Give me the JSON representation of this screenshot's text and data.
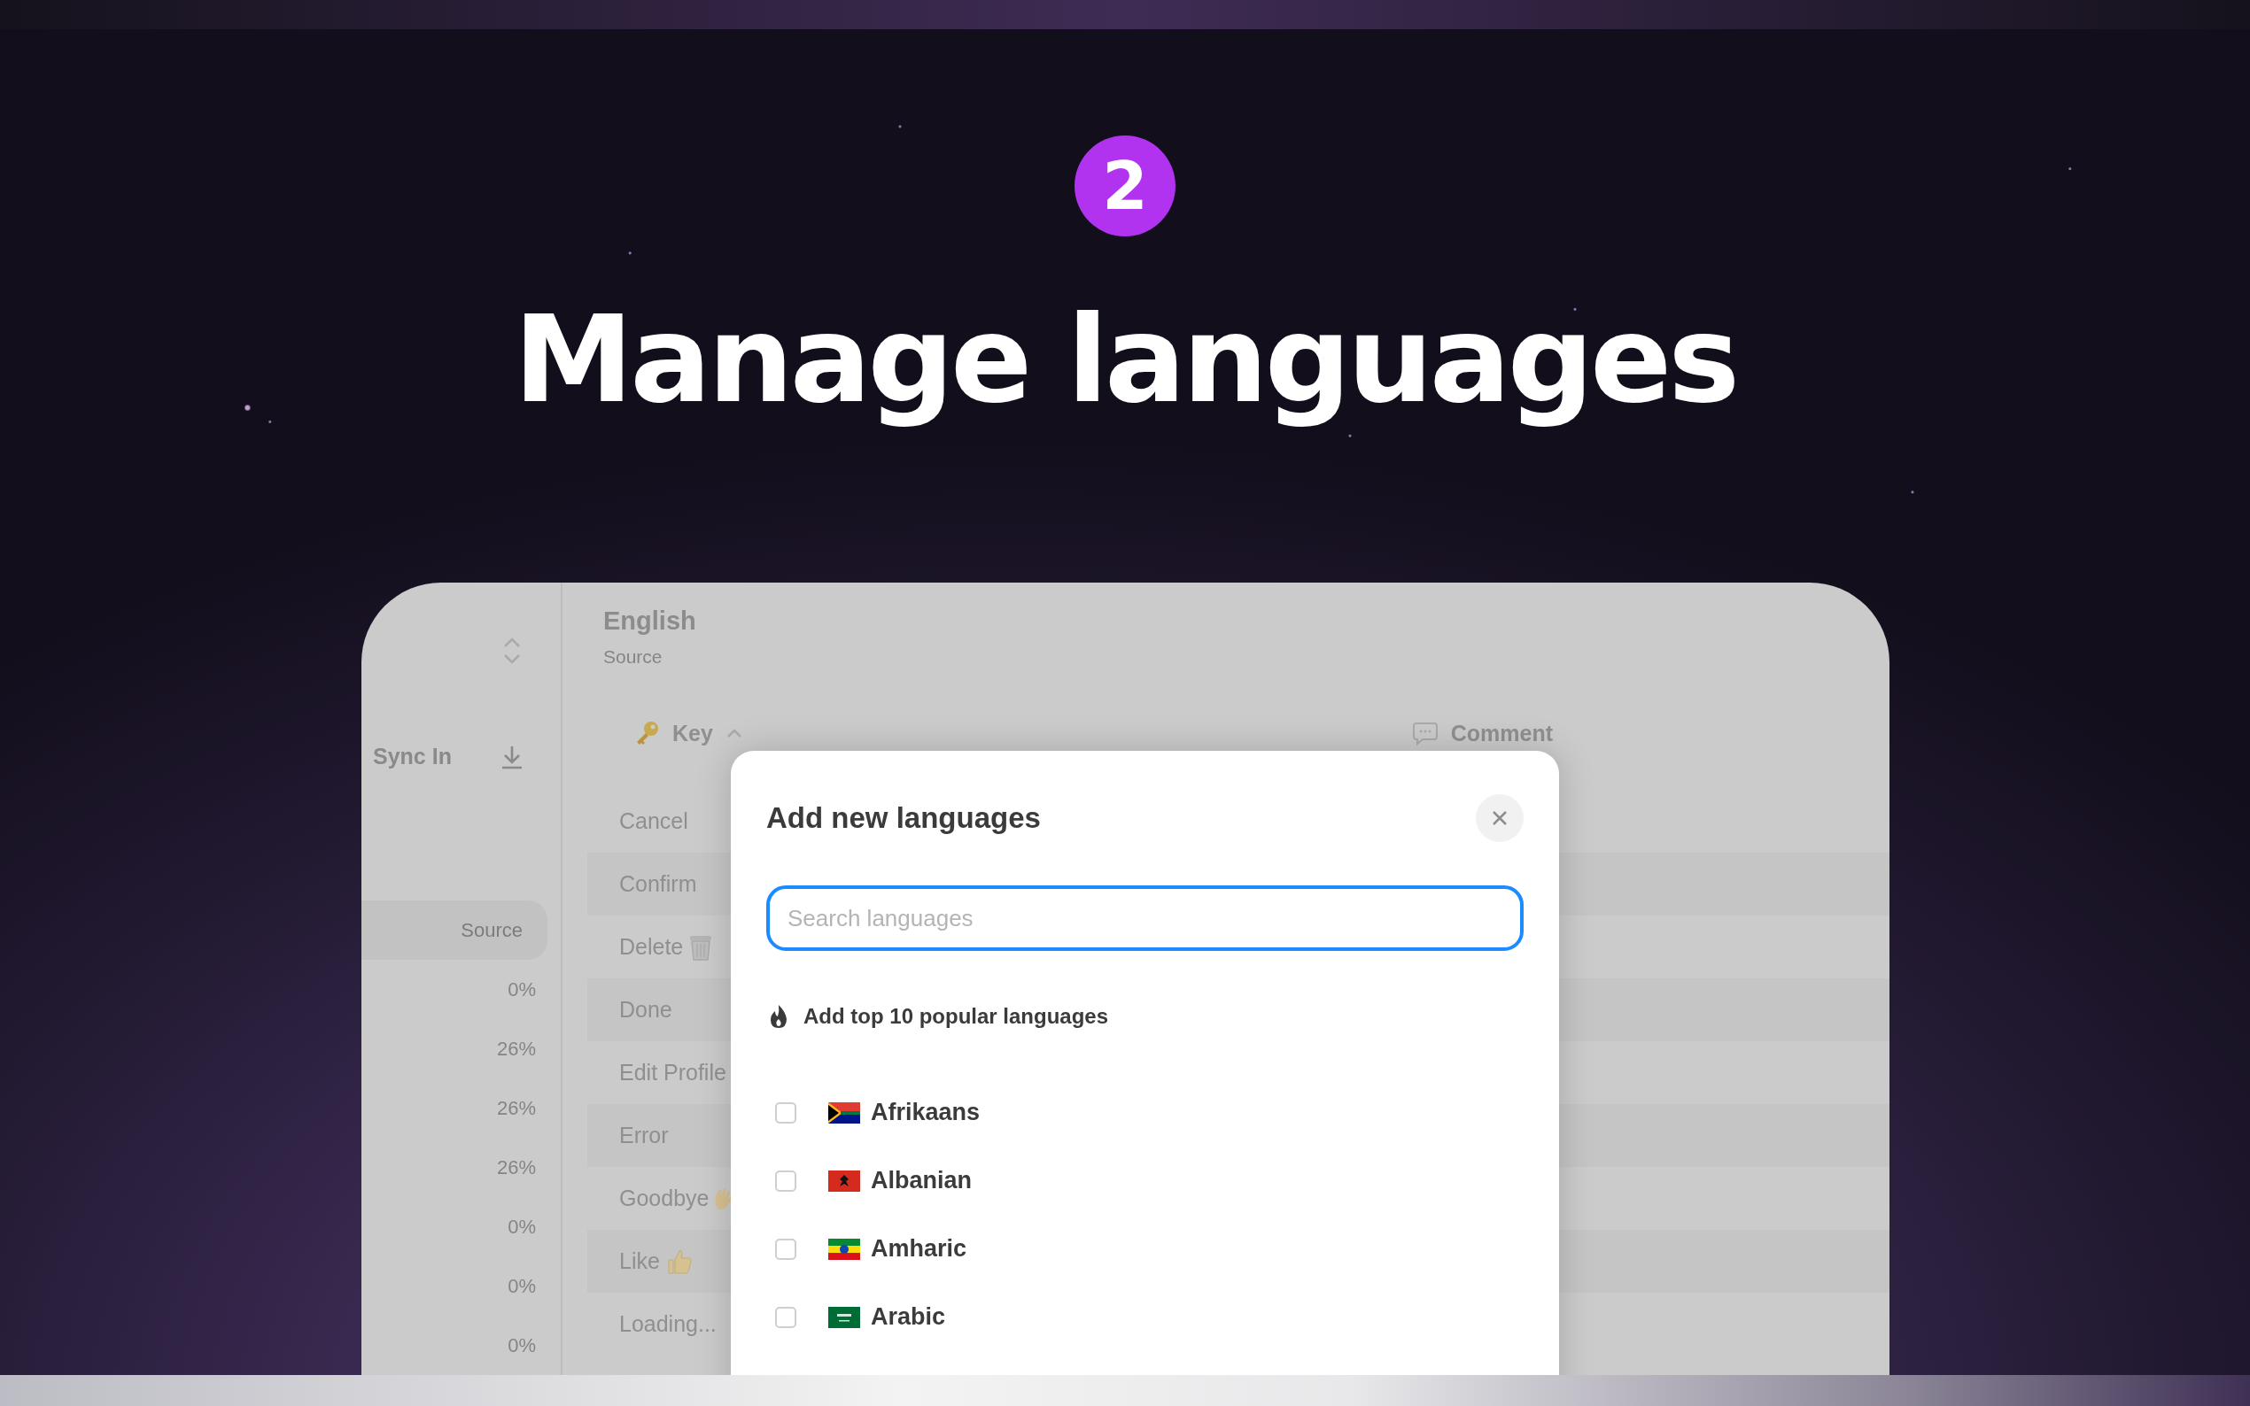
{
  "step_badge": "2",
  "headline": "Manage languages",
  "sidebar": {
    "sync_label": "Sync In",
    "items": [
      {
        "label": "Source",
        "selected": true
      },
      {
        "label": "0%",
        "selected": false
      },
      {
        "label": "26%",
        "selected": false
      },
      {
        "label": "26%",
        "selected": false
      },
      {
        "label": "26%",
        "selected": false
      },
      {
        "label": "0%",
        "selected": false
      },
      {
        "label": "0%",
        "selected": false
      },
      {
        "label": "0%",
        "selected": false
      }
    ]
  },
  "language_header": {
    "title": "English",
    "subtitle": "Source"
  },
  "table": {
    "columns": [
      {
        "label": "Key",
        "kind": "key"
      },
      {
        "label": "Comment",
        "kind": "comment"
      }
    ],
    "rows": [
      {
        "key": "Cancel"
      },
      {
        "key": "Confirm"
      },
      {
        "key": "Delete"
      },
      {
        "key": "Done"
      },
      {
        "key": "Edit Profile"
      },
      {
        "key": "Error"
      },
      {
        "key": "Goodbye"
      },
      {
        "key": "Like"
      },
      {
        "key": "Loading..."
      }
    ]
  },
  "modal": {
    "title": "Add new languages",
    "search": {
      "placeholder": "Search languages"
    },
    "popular_action": "Add top 10 popular languages",
    "languages": [
      {
        "name": "Afrikaans",
        "checked": false
      },
      {
        "name": "Albanian",
        "checked": false
      },
      {
        "name": "Amharic",
        "checked": false
      },
      {
        "name": "Arabic",
        "checked": false
      }
    ]
  }
}
